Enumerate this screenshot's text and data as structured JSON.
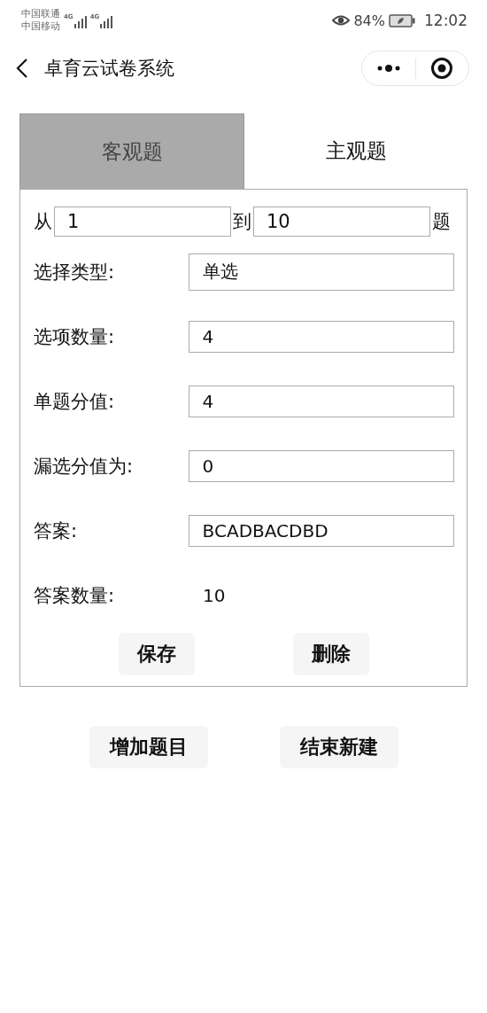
{
  "status_bar": {
    "carriers": [
      "中国联通",
      "中国移动"
    ],
    "network_labels": [
      "4G",
      "4G"
    ],
    "battery": "84%",
    "time": "12:02"
  },
  "nav": {
    "title": "卓育云试卷系统"
  },
  "tabs": [
    {
      "label": "客观题",
      "selected": true
    },
    {
      "label": "主观题",
      "selected": false
    }
  ],
  "range": {
    "from_label": "从",
    "from_value": "1",
    "to_label": "到",
    "to_value": "10",
    "suffix": "题"
  },
  "rows": [
    {
      "kind": "input",
      "label": "选择类型:",
      "value": "单选"
    },
    {
      "kind": "input",
      "label": "选项数量:",
      "value": "4"
    },
    {
      "kind": "input",
      "label": "单题分值:",
      "value": "4"
    },
    {
      "kind": "input",
      "label": "漏选分值为:",
      "value": "0"
    },
    {
      "kind": "input",
      "label": "答案:",
      "value": "BCADBACDBD"
    },
    {
      "kind": "text",
      "label": "答案数量:",
      "value": "10"
    }
  ],
  "panel_buttons": [
    "保存",
    "删除"
  ],
  "buttons": [
    "增加题目",
    "结束新建"
  ]
}
